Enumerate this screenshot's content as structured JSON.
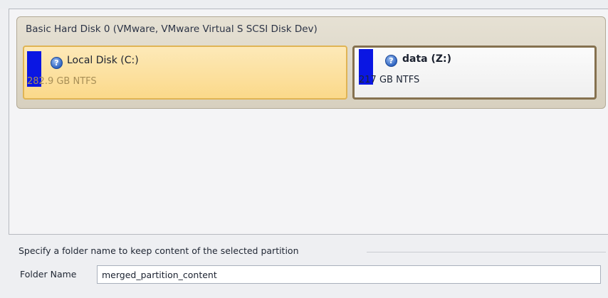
{
  "disk": {
    "title": "Basic Hard Disk 0 (VMware, VMware Virtual S SCSI Disk Dev)",
    "partitions": [
      {
        "name": "Local Disk (C:)",
        "info": "282.9 GB NTFS",
        "icon": "help-icon",
        "color": "#0a16e3",
        "selected": true
      },
      {
        "name": "data (Z:)",
        "info": "217 GB NTFS",
        "icon": "help-icon",
        "color": "#0a16e3",
        "selected": false
      }
    ]
  },
  "folder": {
    "section_label": "Specify a folder name to keep content of the selected partition",
    "field_label": "Folder Name",
    "value": "merged_partition_content"
  },
  "colors": {
    "selected_fill": "#fbd98a",
    "selected_border": "#e0b454",
    "partition_block": "#0a16e3"
  }
}
